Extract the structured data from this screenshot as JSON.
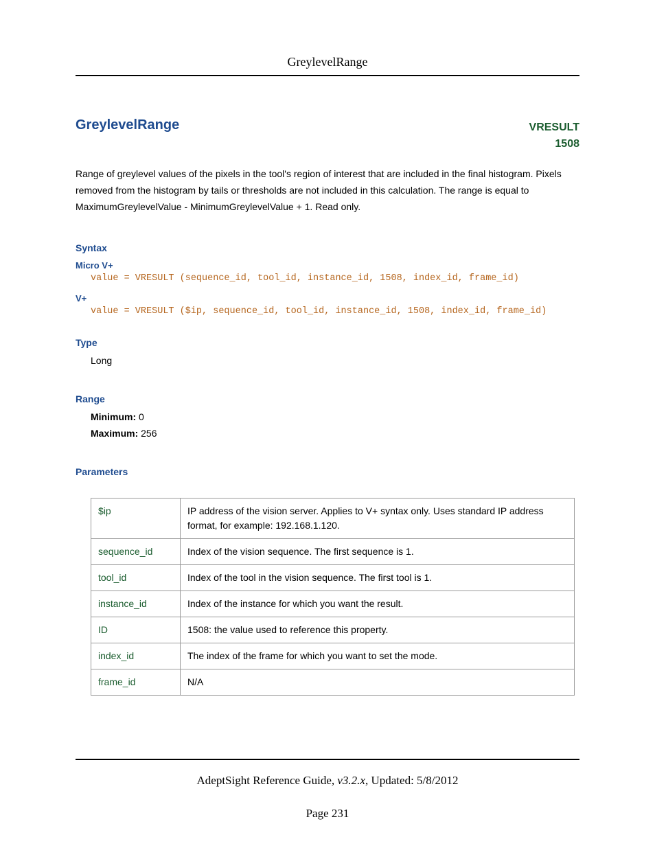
{
  "header": {
    "title": "GreylevelRange"
  },
  "main": {
    "title": "GreylevelRange",
    "tag1": "VRESULT",
    "tag2": "1508",
    "description": "Range of greylevel values of the pixels in the tool's region of interest that are included in the final histogram. Pixels removed from the histogram by tails or thresholds are not included in this calculation. The range is equal to MaximumGreylevelValue - MinimumGreylevelValue + 1. Read only."
  },
  "syntax": {
    "heading": "Syntax",
    "micro_label": "Micro V+",
    "micro_code": "value = VRESULT (sequence_id, tool_id, instance_id, 1508, index_id, frame_id)",
    "vplus_label": "V+",
    "vplus_code": "value = VRESULT ($ip, sequence_id, tool_id, instance_id, 1508, index_id, frame_id)"
  },
  "type": {
    "heading": "Type",
    "value": "Long"
  },
  "range": {
    "heading": "Range",
    "min_label": "Minimum:",
    "min_value": "0",
    "max_label": "Maximum:",
    "max_value": "256"
  },
  "parameters": {
    "heading": "Parameters",
    "rows": [
      {
        "name": "$ip",
        "desc": "IP address of the vision server. Applies to V+ syntax only. Uses standard IP address format, for example: 192.168.1.120."
      },
      {
        "name": "sequence_id",
        "desc": "Index of the vision sequence. The first sequence is 1."
      },
      {
        "name": "tool_id",
        "desc": "Index of the tool in the vision sequence. The first tool is 1."
      },
      {
        "name": "instance_id",
        "desc": "Index of the instance for which you want the result."
      },
      {
        "name": "ID",
        "desc": "1508: the value used to reference this property."
      },
      {
        "name": "index_id",
        "desc": "The index of the frame for which you want to set the mode."
      },
      {
        "name": "frame_id",
        "desc": "N/A"
      }
    ]
  },
  "footer": {
    "book": "AdeptSight Reference Guide",
    "version": ", v3.2.x",
    "updated": ", Updated: 5/8/2012",
    "page": "Page 231"
  }
}
